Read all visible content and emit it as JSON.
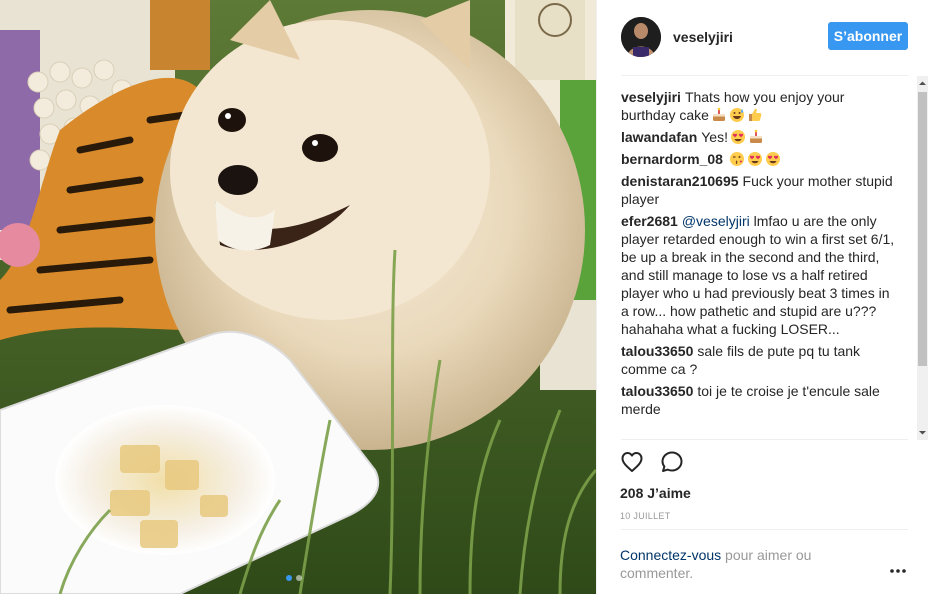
{
  "post": {
    "username": "veselyjiri",
    "follow_label": "S’abonner",
    "likes": "208 J’aime",
    "date": "10 JUILLET",
    "login_link": "Connectez-vous",
    "login_rest": " pour aimer ou commenter."
  },
  "comments": [
    {
      "author": "veselyjiri",
      "text": "Thats how you enjoy your burthday cake",
      "emoji": [
        "cake-emoji",
        "grinning-sweat-emoji",
        "thumbs-up-emoji"
      ]
    },
    {
      "author": "lawandafan",
      "text": "Yes!",
      "emoji": [
        "heart-eyes-emoji",
        "cake-emoji"
      ]
    },
    {
      "author": "bernardorm_08",
      "text": "",
      "emoji": [
        "kissing-heart-emoji",
        "heart-eyes-emoji",
        "heart-eyes-emoji"
      ]
    },
    {
      "author": "denistaran210695",
      "text": "Fuck your mother stupid player",
      "emoji": []
    },
    {
      "author": "efer2681",
      "mention": "@veselyjiri",
      "text": " lmfao u are the only player retarded enough to win a first set 6/1, be up a break in the second and the third, and still manage to lose vs a half retired player who u had previously beat 3 times in a row... how pathetic and stupid are u??? hahahaha what a fucking LOSER...",
      "emoji": []
    },
    {
      "author": "talou33650",
      "text": "sale fils de pute pq tu tank comme ca ?",
      "emoji": []
    },
    {
      "author": "talou33650",
      "text": "toi je te croise je t'encule sale merde",
      "emoji": []
    }
  ],
  "icons": {
    "like": "heart-icon",
    "comment": "comment-icon",
    "more": "more-options-icon"
  },
  "colors": {
    "accent": "#3897f0",
    "link": "#003569",
    "muted": "#999999"
  },
  "carousel": {
    "count": 2,
    "active": 1
  }
}
